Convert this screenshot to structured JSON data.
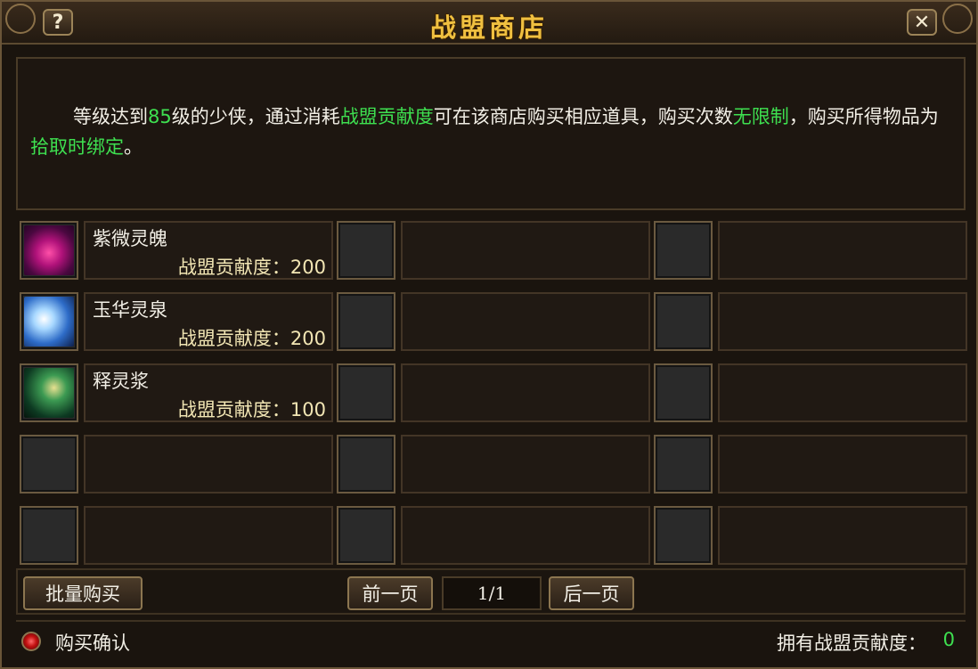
{
  "window": {
    "title": "战盟商店",
    "help_label": "?",
    "close_label": "✕"
  },
  "info": {
    "p1": "等级达到",
    "level": "85",
    "p2": "级的少侠，通过消耗",
    "currency": "战盟贡献度",
    "p3": "可在该商店购买相应道具，购买次数",
    "unlimited": "无限制",
    "p4": "，购买所得物品为",
    "bind": "拾取时绑定",
    "p5": "。"
  },
  "items": [
    {
      "name": "紫微灵魄",
      "cost_label": "战盟贡献度：",
      "cost": "200",
      "icon": "purple-gem-icon"
    },
    {
      "name": "玉华灵泉",
      "cost_label": "战盟贡献度：",
      "cost": "200",
      "icon": "jade-spring-icon"
    },
    {
      "name": "释灵浆",
      "cost_label": "战盟贡献度：",
      "cost": "100",
      "icon": "spirit-wand-icon"
    }
  ],
  "controls": {
    "bulk_buy": "批量购买",
    "prev": "前一页",
    "next": "后一页",
    "page": "1/1"
  },
  "footer": {
    "confirm_label": "购买确认",
    "points_label": "拥有战盟贡献度：",
    "points_value": "0"
  }
}
